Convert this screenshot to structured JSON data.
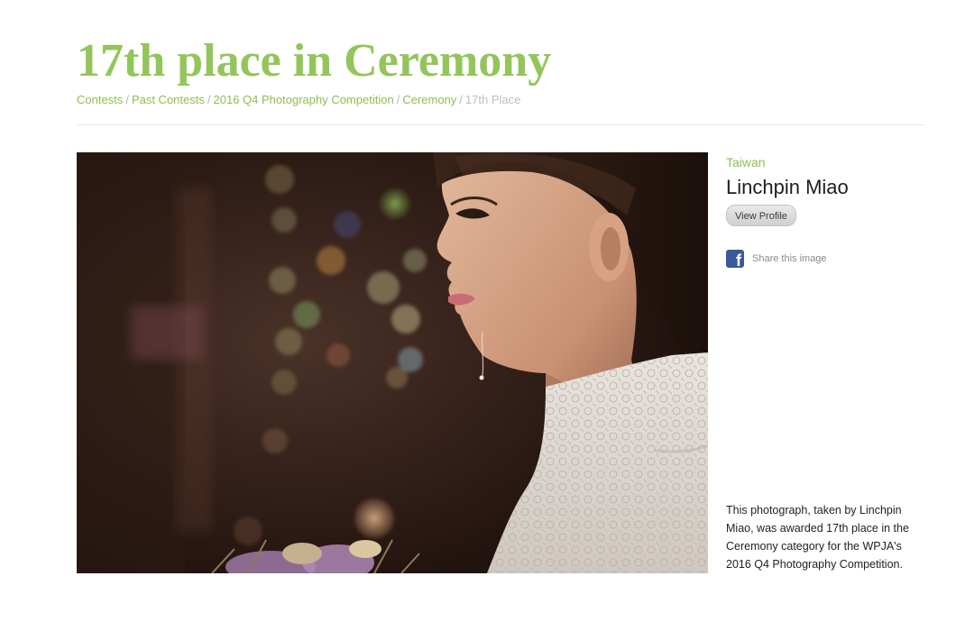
{
  "title": "17th place in Ceremony",
  "breadcrumb": {
    "items": [
      "Contests",
      "Past Contests",
      "2016 Q4 Photography Competition",
      "Ceremony"
    ],
    "current": "17th Place",
    "separator": "/"
  },
  "sidebar": {
    "country": "Taiwan",
    "photographer": "Linchpin Miao",
    "view_profile_label": "View Profile",
    "share_label": "Share this image",
    "share_icon": "facebook-icon",
    "description": "This photograph, taken by Linchpin Miao, was awarded 17th place in the Ceremony category for the WPJA's 2016 Q4 Photography Competition."
  },
  "colors": {
    "accent": "#93c55a",
    "link": "#8cbf4e",
    "facebook": "#3b5998"
  }
}
